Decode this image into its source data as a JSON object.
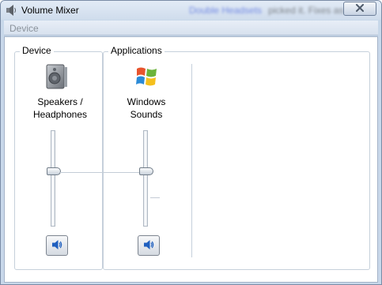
{
  "window": {
    "title": "Volume Mixer",
    "title_icon": "speaker-icon",
    "blurred_title_link": "Double Headsets",
    "blurred_title_text": "picked it. Fixes as",
    "close_icon": "close-icon"
  },
  "menu": {
    "device_label": "Device"
  },
  "device_group": {
    "label": "Device",
    "icon": "speaker-device-icon",
    "channel_name_line1": "Speakers /",
    "channel_name_line2": "Headphones",
    "volume_level": 0.5,
    "mute_icon": "speaker-mute-icon"
  },
  "applications_group": {
    "label": "Applications",
    "apps": [
      {
        "icon": "windows-logo-icon",
        "name_line1": "Windows",
        "name_line2": "Sounds",
        "volume_level": 0.5,
        "mute_icon": "speaker-mute-icon"
      }
    ]
  },
  "colors": {
    "frame": "#c8d8ea",
    "menu_text_disabled": "#8a929b",
    "group_border": "#c6d0db",
    "mute_glyph": "#1f5fbf"
  }
}
